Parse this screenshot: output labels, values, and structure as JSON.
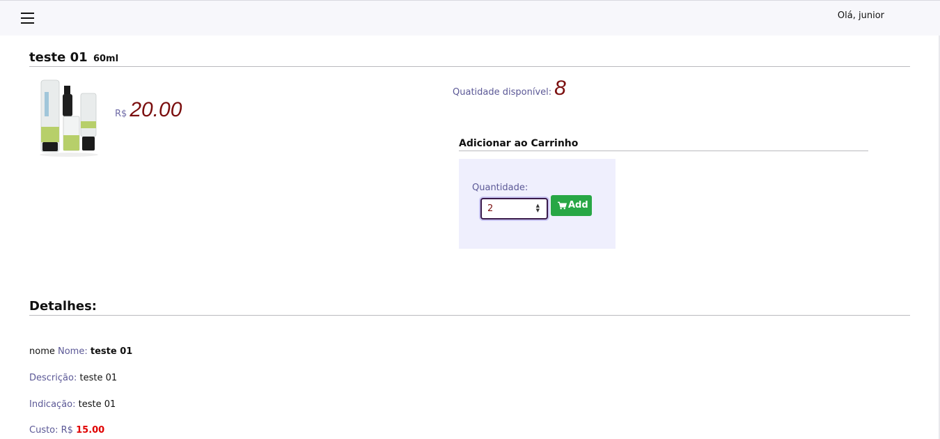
{
  "header": {
    "menu_icon": "hamburger-icon",
    "greeting": "Olá, junior"
  },
  "product": {
    "name": "teste 01",
    "size": "60ml",
    "image_alt": "product-bottles",
    "currency": "R$",
    "price": "20.00",
    "availability_label": "Quatidade disponível:",
    "availability_value": "8"
  },
  "cart": {
    "title": "Adicionar ao Carrinho",
    "quantity_label": "Quantidade:",
    "quantity_value": "2",
    "add_label": "Add",
    "add_icon": "cart-icon"
  },
  "details": {
    "title": "Detalhes:",
    "name_prefix": "nome",
    "name_label": "Nome:",
    "name_value": "teste 01",
    "description_label": "Descrição:",
    "description_value": "teste 01",
    "indication_label": "Indicação:",
    "indication_value": "teste 01",
    "cost_label": "Custo: R$",
    "cost_value": "15.00"
  },
  "colors": {
    "price": "#7b0f0f",
    "label": "#5b5896",
    "add_button": "#28a745",
    "cart_box": "#efeffd",
    "cost": "#e00000"
  }
}
